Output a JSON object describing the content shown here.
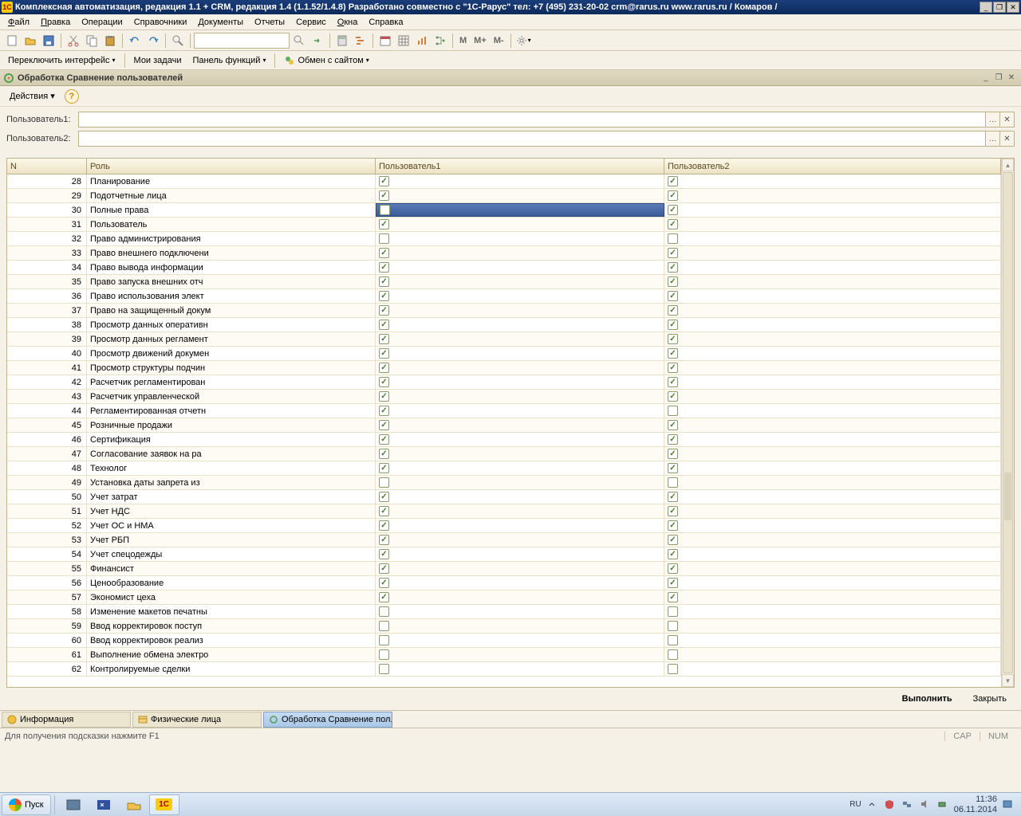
{
  "titlebar": {
    "title": "Комплексная автоматизация, редакция 1.1 + CRM, редакция 1.4 (1.1.52/1.4.8) Разработано совместно с \"1С-Рарус\" тел: +7 (495) 231-20-02 crm@rarus.ru    www.rarus.ru / Комаров /"
  },
  "mainmenu": {
    "items": [
      "Файл",
      "Правка",
      "Операции",
      "Справочники",
      "Документы",
      "Отчеты",
      "Сервис",
      "Окна",
      "Справка"
    ]
  },
  "subtoolbar": {
    "switch_ui": "Переключить интерфейс",
    "my_tasks": "Мои задачи",
    "func_panel": "Панель функций",
    "exchange": "Обмен с сайтом"
  },
  "subwindow": {
    "title": "Обработка  Сравнение пользователей",
    "actions_label": "Действия"
  },
  "userfields": {
    "label1": "Пользователь1:",
    "label2": "Пользователь2:",
    "value1": "",
    "value2": ""
  },
  "table": {
    "headers": {
      "n": "N",
      "role": "Роль",
      "u1": "Пользователь1",
      "u2": "Пользователь2"
    },
    "rows": [
      {
        "n": 28,
        "role": "Планирование",
        "u1": true,
        "u2": true,
        "sel": false
      },
      {
        "n": 29,
        "role": "Подотчетные лица",
        "u1": true,
        "u2": true,
        "sel": false
      },
      {
        "n": 30,
        "role": "Полные права",
        "u1": false,
        "u2": true,
        "sel": true
      },
      {
        "n": 31,
        "role": "Пользователь",
        "u1": true,
        "u2": true,
        "sel": false
      },
      {
        "n": 32,
        "role": "Право администрирования",
        "u1": false,
        "u2": false,
        "sel": false
      },
      {
        "n": 33,
        "role": "Право внешнего подключени",
        "u1": true,
        "u2": true,
        "sel": false
      },
      {
        "n": 34,
        "role": "Право вывода информации",
        "u1": true,
        "u2": true,
        "sel": false
      },
      {
        "n": 35,
        "role": "Право запуска внешних отч",
        "u1": true,
        "u2": true,
        "sel": false
      },
      {
        "n": 36,
        "role": "Право использования элект",
        "u1": true,
        "u2": true,
        "sel": false
      },
      {
        "n": 37,
        "role": "Право на защищенный докум",
        "u1": true,
        "u2": true,
        "sel": false
      },
      {
        "n": 38,
        "role": "Просмотр данных оперативн",
        "u1": true,
        "u2": true,
        "sel": false
      },
      {
        "n": 39,
        "role": "Просмотр данных регламент",
        "u1": true,
        "u2": true,
        "sel": false
      },
      {
        "n": 40,
        "role": "Просмотр движений докумен",
        "u1": true,
        "u2": true,
        "sel": false
      },
      {
        "n": 41,
        "role": "Просмотр структуры подчин",
        "u1": true,
        "u2": true,
        "sel": false
      },
      {
        "n": 42,
        "role": "Расчетчик регламентирован",
        "u1": true,
        "u2": true,
        "sel": false
      },
      {
        "n": 43,
        "role": "Расчетчик управленческой",
        "u1": true,
        "u2": true,
        "sel": false
      },
      {
        "n": 44,
        "role": "Регламентированная отчетн",
        "u1": true,
        "u2": false,
        "sel": false
      },
      {
        "n": 45,
        "role": "Розничные продажи",
        "u1": true,
        "u2": true,
        "sel": false
      },
      {
        "n": 46,
        "role": "Сертификация",
        "u1": true,
        "u2": true,
        "sel": false
      },
      {
        "n": 47,
        "role": "Согласование заявок на ра",
        "u1": true,
        "u2": true,
        "sel": false
      },
      {
        "n": 48,
        "role": "Технолог",
        "u1": true,
        "u2": true,
        "sel": false
      },
      {
        "n": 49,
        "role": "Установка даты запрета из",
        "u1": false,
        "u2": false,
        "sel": false
      },
      {
        "n": 50,
        "role": "Учет затрат",
        "u1": true,
        "u2": true,
        "sel": false
      },
      {
        "n": 51,
        "role": "Учет НДС",
        "u1": true,
        "u2": true,
        "sel": false
      },
      {
        "n": 52,
        "role": "Учет ОС и НМА",
        "u1": true,
        "u2": true,
        "sel": false
      },
      {
        "n": 53,
        "role": "Учет РБП",
        "u1": true,
        "u2": true,
        "sel": false
      },
      {
        "n": 54,
        "role": "Учет спецодежды",
        "u1": true,
        "u2": true,
        "sel": false
      },
      {
        "n": 55,
        "role": "Финансист",
        "u1": true,
        "u2": true,
        "sel": false
      },
      {
        "n": 56,
        "role": "Ценообразование",
        "u1": true,
        "u2": true,
        "sel": false
      },
      {
        "n": 57,
        "role": "Экономист цеха",
        "u1": true,
        "u2": true,
        "sel": false
      },
      {
        "n": 58,
        "role": "Изменение макетов печатны",
        "u1": false,
        "u2": false,
        "sel": false
      },
      {
        "n": 59,
        "role": "Ввод корректировок поступ",
        "u1": false,
        "u2": false,
        "sel": false
      },
      {
        "n": 60,
        "role": "Ввод корректировок реализ",
        "u1": false,
        "u2": false,
        "sel": false
      },
      {
        "n": 61,
        "role": "Выполнение обмена электро",
        "u1": false,
        "u2": false,
        "sel": false
      },
      {
        "n": 62,
        "role": "Контролируемые сделки",
        "u1": false,
        "u2": false,
        "sel": false
      }
    ]
  },
  "bottombtns": {
    "execute": "Выполнить",
    "close": "Закрыть"
  },
  "bottomtabs": {
    "tab1": "Информация",
    "tab2": "Физические лица",
    "tab3": "Обработка  Сравнение пол..."
  },
  "statusbar": {
    "msg": "Для получения подсказки нажмите F1",
    "cap": "CAP",
    "num": "NUM"
  },
  "taskbar": {
    "start": "Пуск",
    "lang": "RU",
    "time": "11:36",
    "date": "06.11.2014"
  }
}
